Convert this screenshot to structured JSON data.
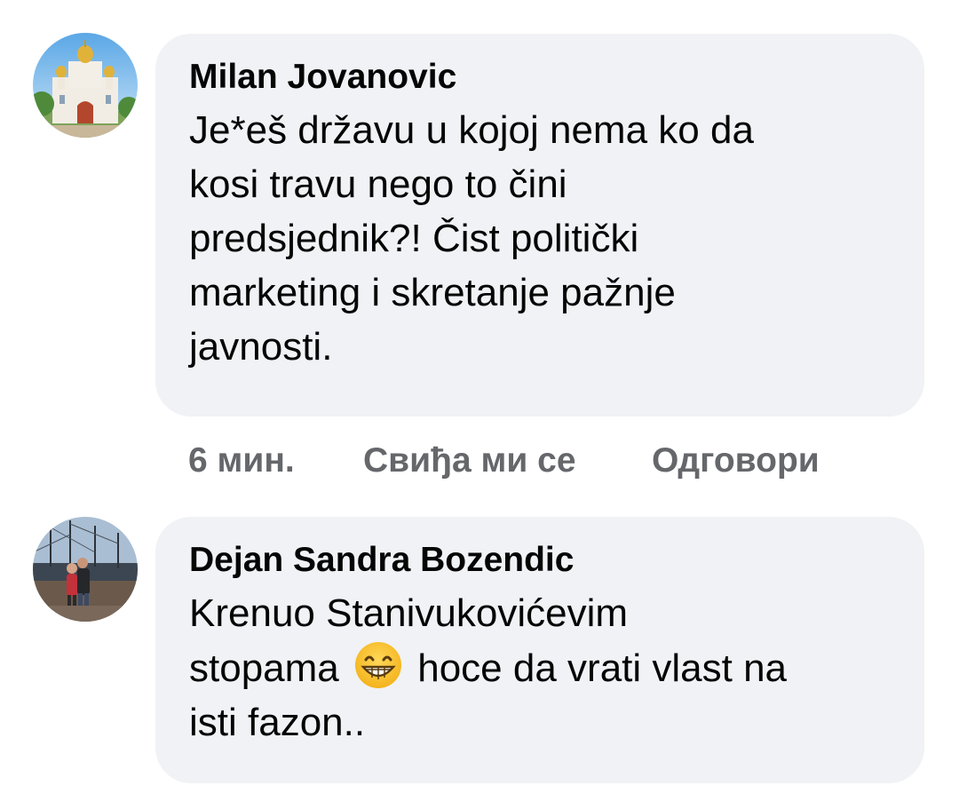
{
  "comments": [
    {
      "author": "Milan Jovanovic",
      "avatar_icon": "church-photo-avatar",
      "text_lines": [
        "Je*eš državu u kojoj nema ko da",
        "kosi travu nego to čini",
        "predsjednik?! Čist politički",
        "marketing i skretanje pažnje",
        "javnosti."
      ],
      "time": "6 мин.",
      "like_label": "Свиђа ми се",
      "reply_label": "Одговори"
    },
    {
      "author": "Dejan Sandra Bozendic",
      "avatar_icon": "couple-ship-photo-avatar",
      "text_line1": "Krenuo Stanivukovićevim",
      "text_line2_before": "stopama",
      "emoji": "grinning-face-emoji",
      "text_line2_after": "hoce da vrati vlast na",
      "text_line3": "isti fazon.."
    }
  ],
  "colors": {
    "bubble_bg": "#f0f2f5",
    "text": "#050505",
    "meta": "#65676b"
  }
}
